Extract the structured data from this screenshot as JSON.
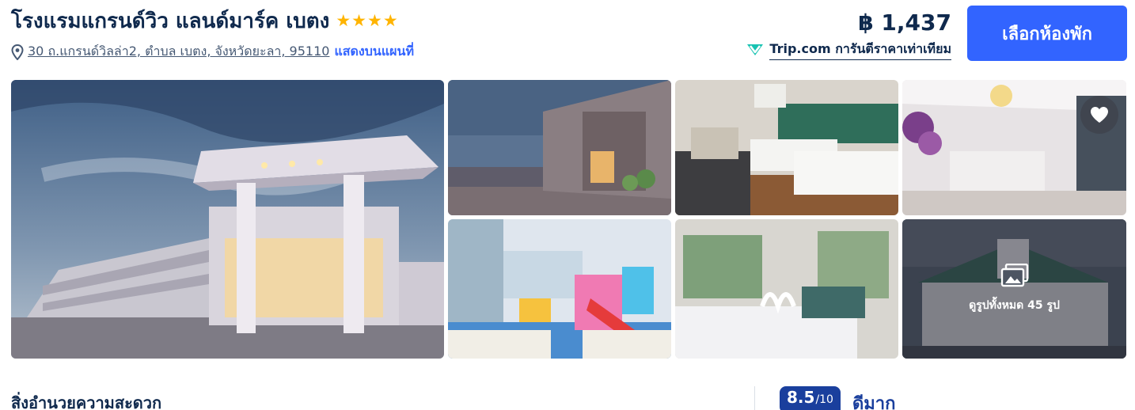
{
  "hotel": {
    "name": "โรงแรมแกรนด์วิว แลนด์มาร์ค เบตง",
    "star_rating": 4,
    "address": "30 ถ.แกรนด์วิลล่า2, ตำบล เบตง, จังหวัดยะลา, 95110",
    "map_link": "แสดงบนแผนที่"
  },
  "pricing": {
    "price": "฿ 1,437",
    "guarantee_brand": "Trip.com",
    "guarantee_text": "การันตีราคาเท่าเทียม",
    "select_button": "เลือกห้องพัก"
  },
  "gallery": {
    "all_photos_label": "ดูรูปทั้งหมด 45 รูป",
    "photos": [
      "hotel-exterior-night",
      "hotel-street-entrance",
      "twin-bedroom",
      "lobby-reception",
      "kids-playroom",
      "bedroom-towel-swans",
      "hotel-aerial-view"
    ]
  },
  "amenities": {
    "title": "สิ่งอำนวยความสะดวก"
  },
  "review": {
    "score": "8.5",
    "max": "/10",
    "label": "ดีมาก"
  },
  "colors": {
    "accent": "#3264ff",
    "star": "#ffb400",
    "score_bg": "#1a3f9d"
  },
  "icons": [
    "map-pin-icon",
    "star-icon",
    "trip-guarantee-icon",
    "heart-icon",
    "gallery-icon"
  ]
}
